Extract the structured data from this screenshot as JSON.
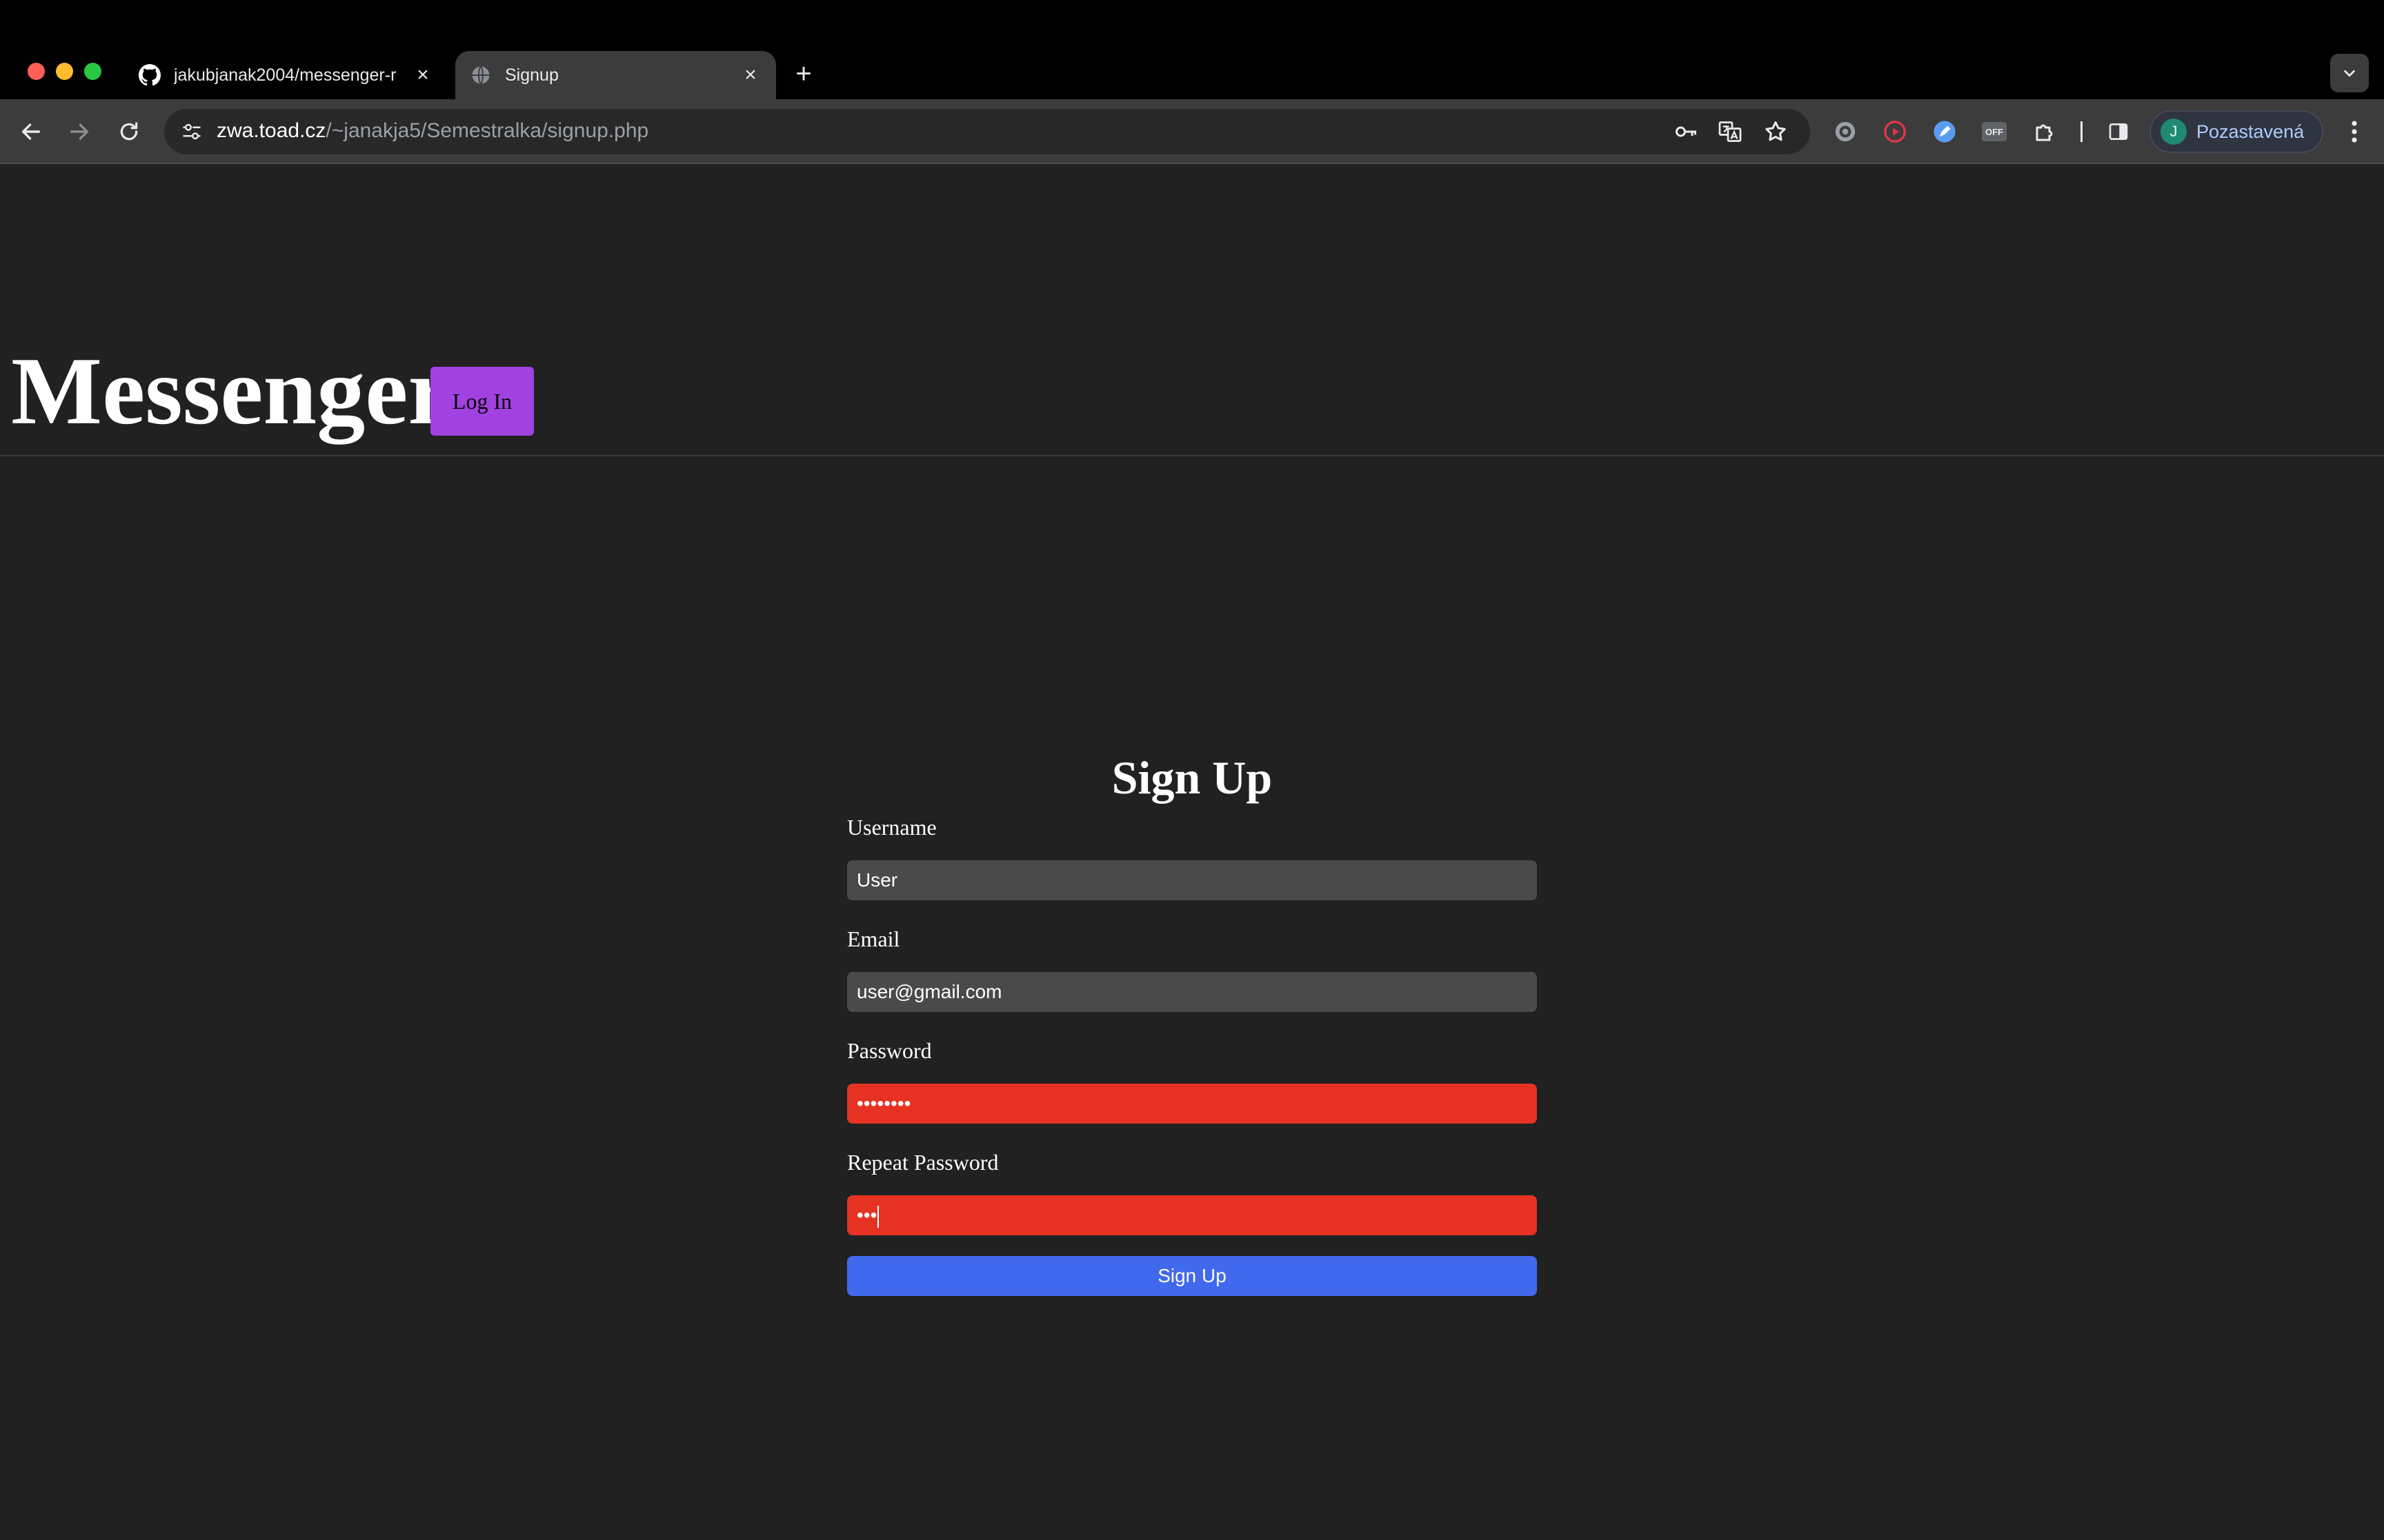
{
  "browser": {
    "tabs": [
      {
        "title": "jakubjanak2004/messenger-r",
        "icon": "github-icon",
        "active": false
      },
      {
        "title": "Signup",
        "icon": "globe-icon",
        "active": true
      }
    ],
    "new_tab_symbol": "+",
    "close_symbol": "×",
    "url_host": "zwa.toad.cz",
    "url_path": "/~janakja5/Semestralka/signup.php",
    "profile_initial": "J",
    "profile_label": "Pozastavená",
    "ext_off_label": "OFF"
  },
  "site": {
    "brand": "Messenger",
    "login_label": "Log In"
  },
  "form": {
    "title": "Sign Up",
    "username_label": "Username",
    "username_value": "User",
    "email_label": "Email",
    "email_value": "user@gmail.com",
    "password_label": "Password",
    "password_value": "••••••••",
    "repeat_label": "Repeat Password",
    "repeat_value": "•••",
    "submit_label": "Sign Up"
  },
  "colors": {
    "page_background": "#212121",
    "login_button": "#a142e0",
    "input_default": "#4a4a4a",
    "input_error": "#e53222",
    "submit_button": "#4169ee"
  }
}
